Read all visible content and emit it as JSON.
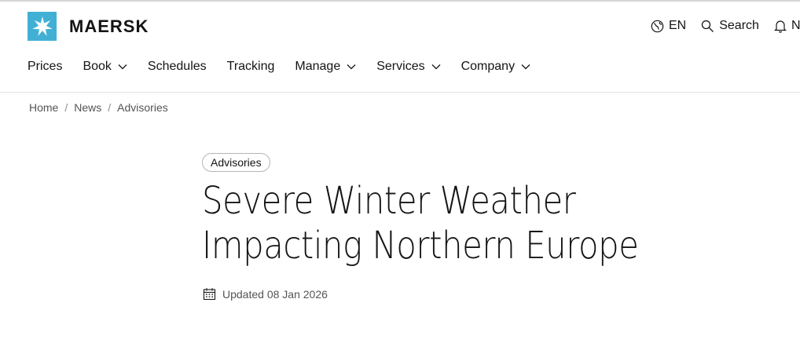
{
  "brand": {
    "name": "MAERSK",
    "color": "#42b0d5"
  },
  "utility": {
    "language": {
      "label": "EN",
      "icon": "globe-icon"
    },
    "search": {
      "label": "Search",
      "icon": "search-icon"
    },
    "notifications": {
      "label": "No",
      "icon": "bell-icon"
    }
  },
  "nav": {
    "items": [
      {
        "label": "Prices",
        "dropdown": false
      },
      {
        "label": "Book",
        "dropdown": true
      },
      {
        "label": "Schedules",
        "dropdown": false
      },
      {
        "label": "Tracking",
        "dropdown": false
      },
      {
        "label": "Manage",
        "dropdown": true
      },
      {
        "label": "Services",
        "dropdown": true
      },
      {
        "label": "Company",
        "dropdown": true
      }
    ]
  },
  "breadcrumb": {
    "items": [
      "Home",
      "News",
      "Advisories"
    ],
    "separator": "/"
  },
  "article": {
    "tag": "Advisories",
    "title": "Severe Winter Weather Impacting Northern Europe",
    "updated": "Updated 08 Jan 2026",
    "updated_icon": "calendar-icon"
  }
}
